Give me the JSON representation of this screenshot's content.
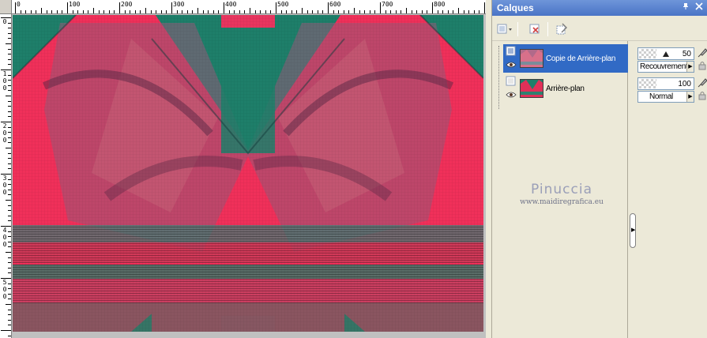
{
  "canvas": {
    "ruler_h_labels": [
      "0",
      "100",
      "200",
      "300",
      "400",
      "500",
      "600",
      "700",
      "800"
    ],
    "ruler_v_labels": [
      [
        "0"
      ],
      [
        "1",
        "0",
        "0"
      ],
      [
        "2",
        "0",
        "0"
      ],
      [
        "3",
        "0",
        "0"
      ],
      [
        "4",
        "0",
        "0"
      ],
      [
        "5",
        "0",
        "0"
      ]
    ],
    "image_colors": {
      "teal": "#1E7F6A",
      "pink": "#F0305A",
      "dark_pink": "#C83A5A",
      "mauve": "#8A5A78"
    }
  },
  "layers_panel": {
    "title": "Calques",
    "pin_icon": "pin-icon",
    "close_icon": "close-icon",
    "toolbar": [
      "new-layer-icon",
      "delete-layer-icon",
      "layer-properties-icon"
    ],
    "layers": [
      {
        "name": "Copie de Arrière-plan",
        "selected": true,
        "visible": true,
        "opacity": "50",
        "blend_mode": "Recouvrement"
      },
      {
        "name": "Arrière-plan",
        "selected": false,
        "visible": true,
        "opacity": "100",
        "blend_mode": "Normal"
      }
    ],
    "watermark": {
      "name": "Pinuccia",
      "url": "www.maidiregrafica.eu"
    },
    "colors": {
      "selection": "#316AC5",
      "title_bar": "#4A74C6",
      "panel_bg": "#ECE9D8"
    }
  }
}
